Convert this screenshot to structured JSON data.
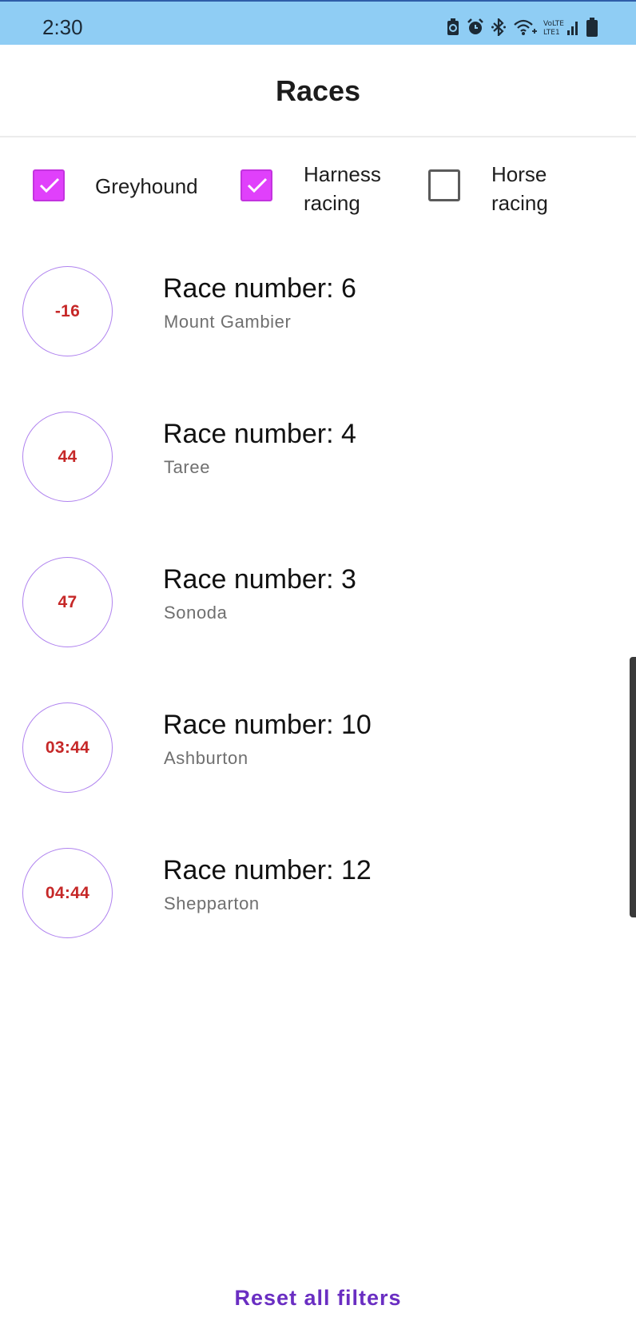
{
  "status_bar": {
    "time": "2:30",
    "icons": [
      "battery-saver-icon",
      "alarm-icon",
      "bluetooth-icon",
      "wifi-icon",
      "signal-icon",
      "battery-icon"
    ]
  },
  "app_bar": {
    "title": "Races"
  },
  "filters": [
    {
      "label": "Greyhound",
      "checked": true
    },
    {
      "label": "Harness racing",
      "checked": true
    },
    {
      "label": "Horse racing",
      "checked": false
    }
  ],
  "races": [
    {
      "countdown": "-16",
      "title": "Race number: 6",
      "venue": "Mount Gambier"
    },
    {
      "countdown": "44",
      "title": "Race number: 4",
      "venue": "Taree"
    },
    {
      "countdown": "47",
      "title": "Race number: 3",
      "venue": "Sonoda"
    },
    {
      "countdown": "03:44",
      "title": "Race number: 10",
      "venue": "Ashburton"
    },
    {
      "countdown": "04:44",
      "title": "Race number: 12",
      "venue": "Shepparton"
    }
  ],
  "reset_button": {
    "label": "Reset all filters"
  },
  "colors": {
    "status_bar": "#8fcdf4",
    "checkbox_checked": "#e040fb",
    "countdown_text": "#c62828",
    "countdown_ring": "#b083ef",
    "reset_text": "#6a2ec2"
  }
}
